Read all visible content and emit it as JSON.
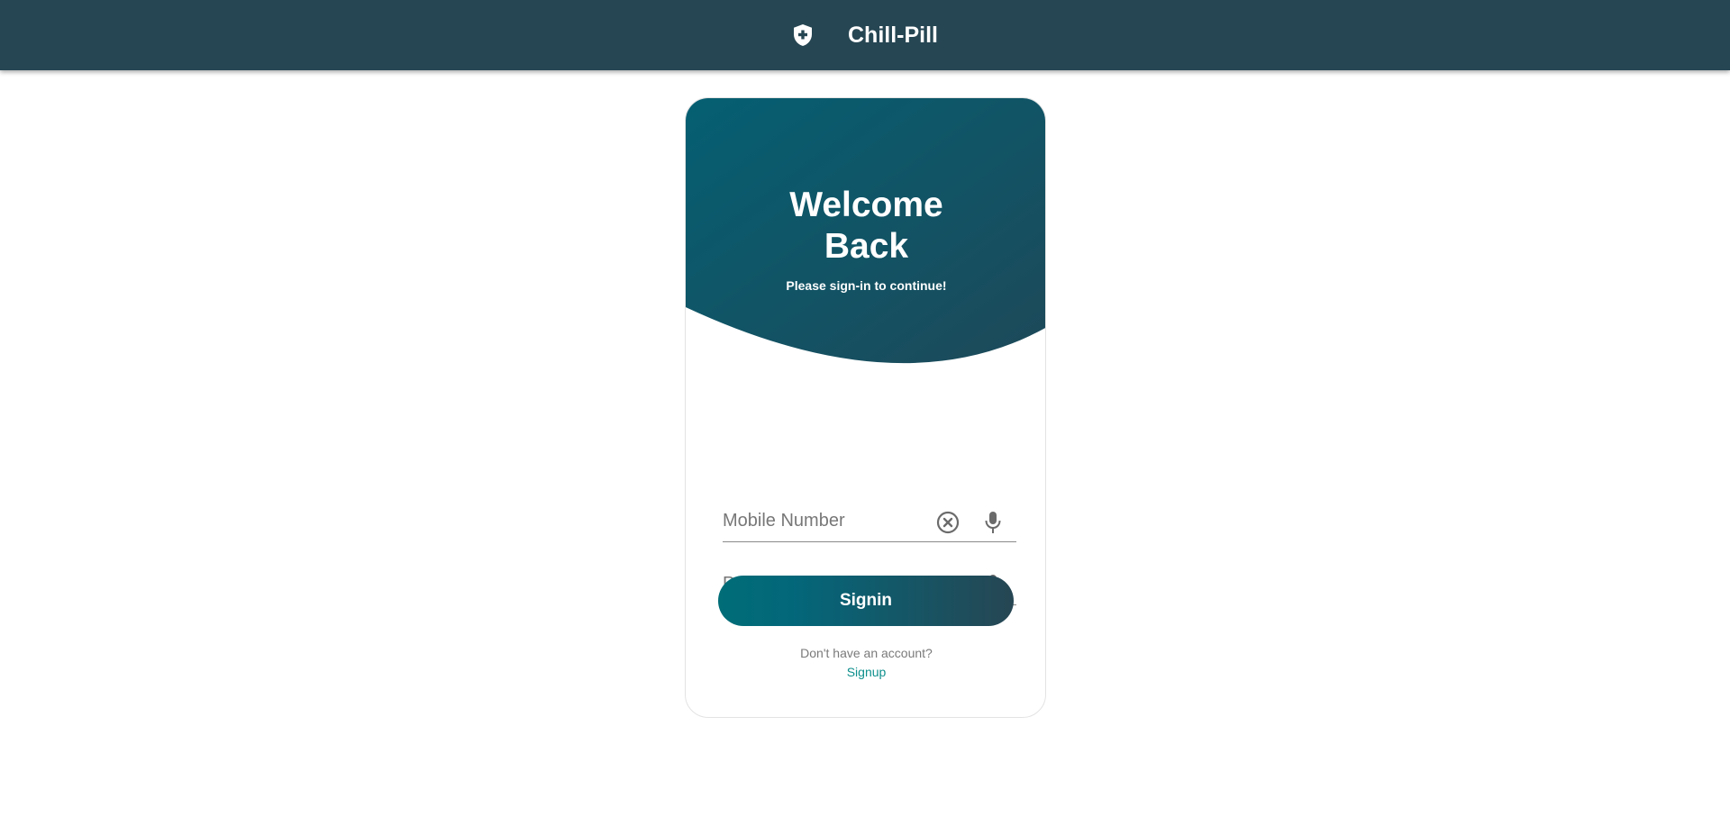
{
  "header": {
    "title": "Chill-Pill",
    "logo_icon": "shield-plus-icon",
    "background": "#264653"
  },
  "login": {
    "title": "Welcome Back",
    "subtitle": "Please sign-in to continue!",
    "hero_gradient": [
      "#055f72",
      "#1b4b5c"
    ],
    "mobile": {
      "placeholder": "Mobile Number",
      "value": "",
      "icons": [
        "clear-circle-icon",
        "microphone-icon"
      ]
    },
    "password": {
      "placeholder": "Password",
      "value": "",
      "icons": [
        "eye-icon",
        "microphone-icon"
      ]
    },
    "signin_label": "Signin",
    "signin_gradient": [
      "#006d77",
      "#264653"
    ],
    "no_account_text": "Don't have an account?",
    "signup_label": "Signup",
    "accent": "#0d8f8c"
  }
}
